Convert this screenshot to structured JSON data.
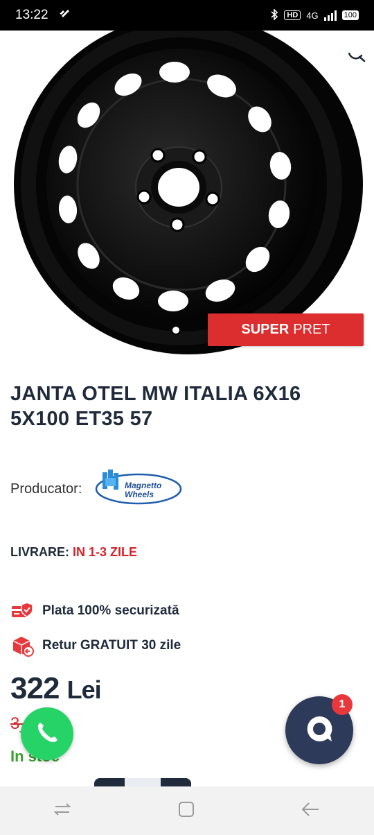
{
  "status_bar": {
    "time": "13:22",
    "network_hd": "HD",
    "network_type": "4G",
    "battery": "100"
  },
  "product": {
    "badge_strong": "SUPER",
    "badge_text": "PRET",
    "title": "JANTA OTEL MW ITALIA 6X16 5X100 ET35 57",
    "producer_label": "Producator:",
    "brand_line1": "Magnetto",
    "brand_line2": "Wheels",
    "delivery_label": "LIVRARE:",
    "delivery_value": "IN 1-3 ZILE",
    "features": [
      {
        "text": "Plata 100% securizată",
        "icon": "secure-card-icon"
      },
      {
        "text": "Retur GRATUIT 30 zile",
        "icon": "return-box-icon"
      }
    ],
    "price_value": "322",
    "price_currency": "Lei",
    "old_price": "3__ __i",
    "stock": "In stoc"
  },
  "chat": {
    "unread_count": "1"
  },
  "colors": {
    "accent_red": "#dc2d2f",
    "title_navy": "#1f2a3a",
    "stock_green": "#3aa12f",
    "whatsapp_green": "#25d366",
    "chat_navy": "#2e3a5a"
  },
  "icons": [
    "whatsapp-icon",
    "chat-bubble-icon",
    "search-icon",
    "nav-recent-icon",
    "nav-home-icon",
    "nav-back-icon"
  ]
}
